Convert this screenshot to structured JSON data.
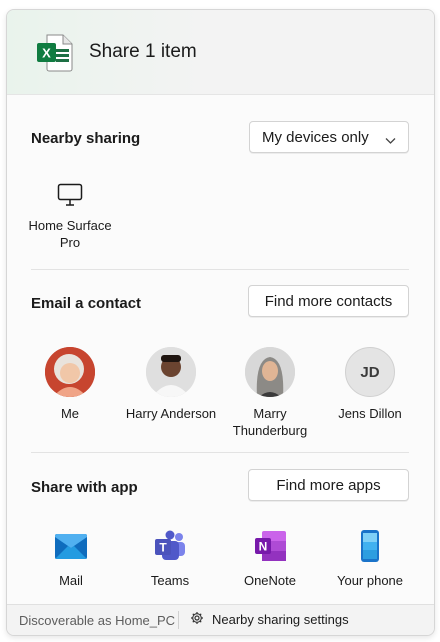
{
  "header": {
    "title": "Share 1 item",
    "file_icon": "excel-file-icon"
  },
  "nearby": {
    "title": "Nearby sharing",
    "dropdown_value": "My devices only",
    "devices": [
      {
        "label": "Home Surface Pro",
        "icon": "monitor-icon"
      }
    ]
  },
  "email": {
    "title": "Email a contact",
    "find_button": "Find more contacts",
    "contacts": [
      {
        "label": "Me"
      },
      {
        "label": "Harry Anderson"
      },
      {
        "label": "Marry Thunderburg"
      },
      {
        "label": "Jens Dillon",
        "initials": "JD"
      }
    ]
  },
  "apps": {
    "title": "Share with app",
    "find_button": "Find more apps",
    "items": [
      {
        "label": "Mail",
        "icon": "mail-icon"
      },
      {
        "label": "Teams",
        "icon": "teams-icon"
      },
      {
        "label": "OneNote",
        "icon": "onenote-icon"
      },
      {
        "label": "Your phone",
        "icon": "phone-icon"
      }
    ]
  },
  "footer": {
    "discoverable": "Discoverable as Home_PC",
    "settings_label": "Nearby sharing settings"
  },
  "colors": {
    "excel_green": "#1d7044",
    "teams_purple": "#5059c9",
    "onenote_purple": "#7719aa",
    "mail_blue": "#0f6cbd",
    "phone_blue": "#2d9ee0"
  }
}
